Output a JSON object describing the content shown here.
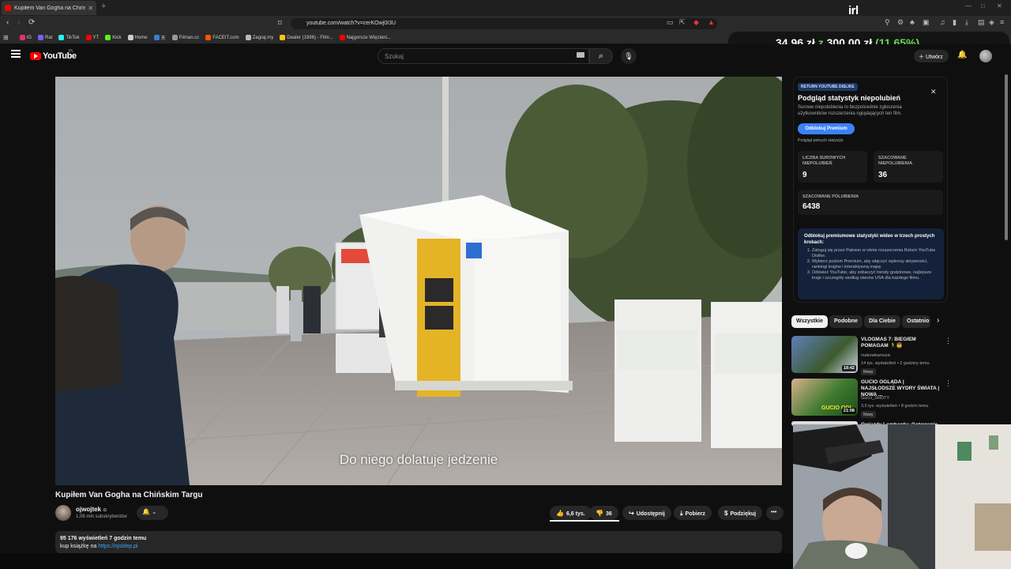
{
  "browser": {
    "tab_title": "Kupiłem Van Gogha na Chińs",
    "url": "youtube.com/watch?v=cerKOwj0I3U",
    "bookmarks": [
      {
        "label": "IG",
        "color": "#e1306c"
      },
      {
        "label": "Rat",
        "color": "#7b5cff"
      },
      {
        "label": "TikTok",
        "color": "#25f4ee"
      },
      {
        "label": "YT",
        "color": "#ff0000"
      },
      {
        "label": "Kick",
        "color": "#53fc18"
      },
      {
        "label": "Home",
        "color": "#cccccc"
      },
      {
        "label": "天",
        "color": "#3a7bd5"
      },
      {
        "label": "Filman.cc",
        "color": "#999999"
      },
      {
        "label": "FACEIT.com",
        "color": "#ff5500"
      },
      {
        "label": "Zagraj.my",
        "color": "#bbbbbb"
      },
      {
        "label": "Dealer (1996) - Film...",
        "color": "#f5c518"
      },
      {
        "label": "Najgorsze Więzieni...",
        "color": "#ff0000"
      }
    ]
  },
  "overlay": {
    "brand": "irl",
    "donation_current": "34,96 zł",
    "donation_sep": "z",
    "donation_goal": "300,00 zł",
    "donation_percent": "(11.65%)"
  },
  "youtube": {
    "logo_text": "YouTube",
    "region": "PL",
    "search_placeholder": "Szukaj",
    "create_label": "Utwórz"
  },
  "video": {
    "subtitle": "Do niego dolatuje jedzenie",
    "title": "Kupiłem Van Gogha na Chińskim Targu",
    "channel": "ojwojtek",
    "verified": "⊙",
    "subscribers": "1,06 mln subskrybentów",
    "likes": "6,6 tys.",
    "dislikes": "36",
    "share_label": "Udostępnij",
    "download_label": "Pobierz",
    "thanks_label": "Podziękuj",
    "views_line": "95 176 wyświetleń  7 godzin temu",
    "desc_text": "kup książkę na ",
    "desc_link": "https://ojsklep.pl"
  },
  "rytd": {
    "badge": "RETURN YOUTUBE DISLIKE",
    "title": "Podgląd statystyk niepolubień",
    "description": "Surowe niepolubienia to bezpośrednie zgłoszenia użytkowników rozszerzenia oglądających ten film.",
    "premium_button": "Odblokuj Premium",
    "full_stats_link": "Podgląd pełnych statystyk",
    "raw_dislikes_label": "LICZBA SUROWYCH NIEPOLUBIEŃ",
    "raw_dislikes": "9",
    "est_dislikes_label": "SZACOWANE NIEPOLUBIENIA",
    "est_dislikes": "36",
    "est_likes_label": "SZACOWANE POLUBIENIA",
    "est_likes": "6438",
    "unlock_title": "Odblokuj premiumowe statystyki wideo w trzech prostych krokach:",
    "steps": [
      "Zaloguj się przez Patreon w oknie rozszerzenia Return YouTube Dislike.",
      "Wybierz poziom Premium, aby włączyć wykresy aktywności, rankingi krajów i interaktywną mapę.",
      "Odśwież YouTube, aby zobaczyć trendy godzinowe, najlepsze kraje i szczegóły według stanów USA dla każdego filmu."
    ]
  },
  "chips": [
    "Wszystkie",
    "Podobne",
    "Dla Ciebie",
    "Ostatnio"
  ],
  "recommendations": [
    {
      "title": "VLOGMAS 7: BIEGIEM POMAGAM 🏃🤠",
      "channel": "makowkamusic",
      "meta": "14 tys. wyświetleń • 2 godziny temu",
      "badge": "Nowy",
      "duration": "18:42"
    },
    {
      "title": "GUCIO OGLĄDA | NAJSŁODSZE WYDRY ŚWIATA | NOWA ...",
      "channel": "Gucci_SHOTY",
      "meta": "3,5 tys. wyświetleń • 8 godzin temu",
      "badge": "Nowy",
      "duration": "21:08",
      "thumb_text": "GUCIO OGL"
    },
    {
      "title": "Gwiazdy Lombardu: Gotowanie",
      "channel": "",
      "meta": "",
      "badge": "",
      "duration": ""
    }
  ]
}
